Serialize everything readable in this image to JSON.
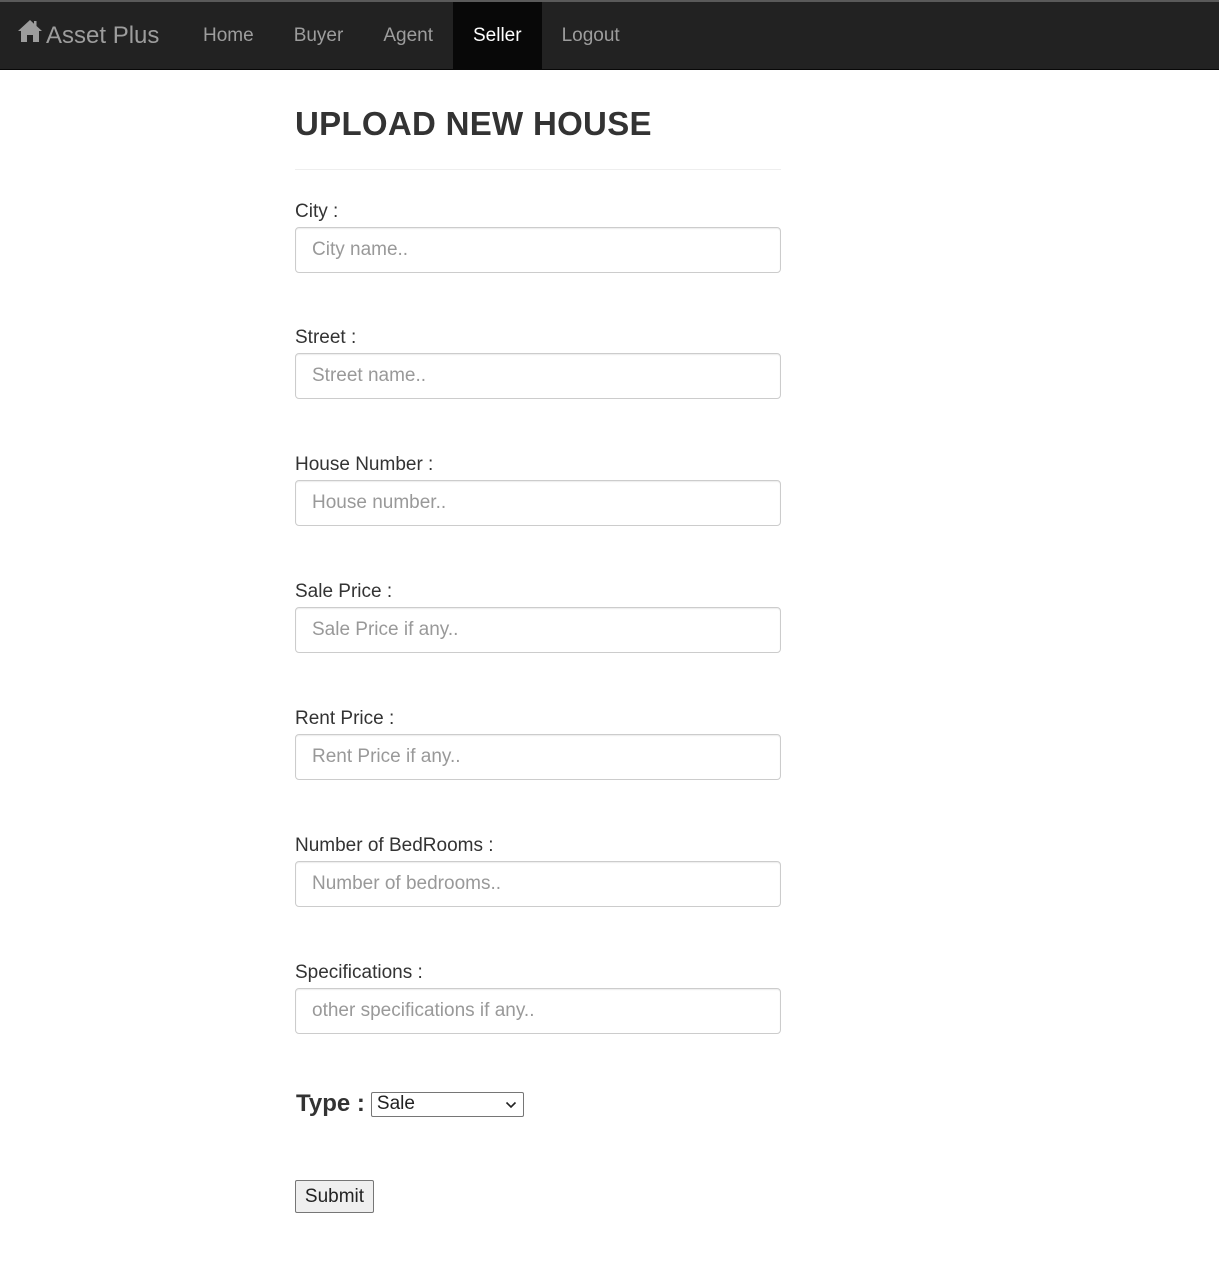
{
  "nav": {
    "brand": "Asset Plus",
    "items": [
      {
        "label": "Home"
      },
      {
        "label": "Buyer"
      },
      {
        "label": "Agent"
      },
      {
        "label": "Seller",
        "active": true
      },
      {
        "label": "Logout"
      }
    ]
  },
  "form": {
    "title": "UPLOAD NEW HOUSE",
    "fields": [
      {
        "label": "City :",
        "placeholder": "City name..",
        "value": ""
      },
      {
        "label": "Street :",
        "placeholder": "Street name..",
        "value": ""
      },
      {
        "label": "House Number :",
        "placeholder": "House number..",
        "value": ""
      },
      {
        "label": "Sale Price :",
        "placeholder": "Sale Price if any..",
        "value": ""
      },
      {
        "label": "Rent Price :",
        "placeholder": "Rent Price if any..",
        "value": ""
      },
      {
        "label": "Number of BedRooms :",
        "placeholder": "Number of bedrooms..",
        "value": ""
      },
      {
        "label": "Specifications :",
        "placeholder": "other specifications if any..",
        "value": ""
      }
    ],
    "type_label": "Type :",
    "type_selected": "Sale",
    "submit_label": "Submit"
  },
  "colors": {
    "navbar_bg": "#222222",
    "navbar_active_bg": "#080808",
    "nav_text": "#9d9d9d",
    "nav_active_text": "#ffffff",
    "heading_text": "#333333"
  },
  "icons": {
    "brand_icon": "home-icon",
    "select_icon": "chevron-down-icon"
  }
}
